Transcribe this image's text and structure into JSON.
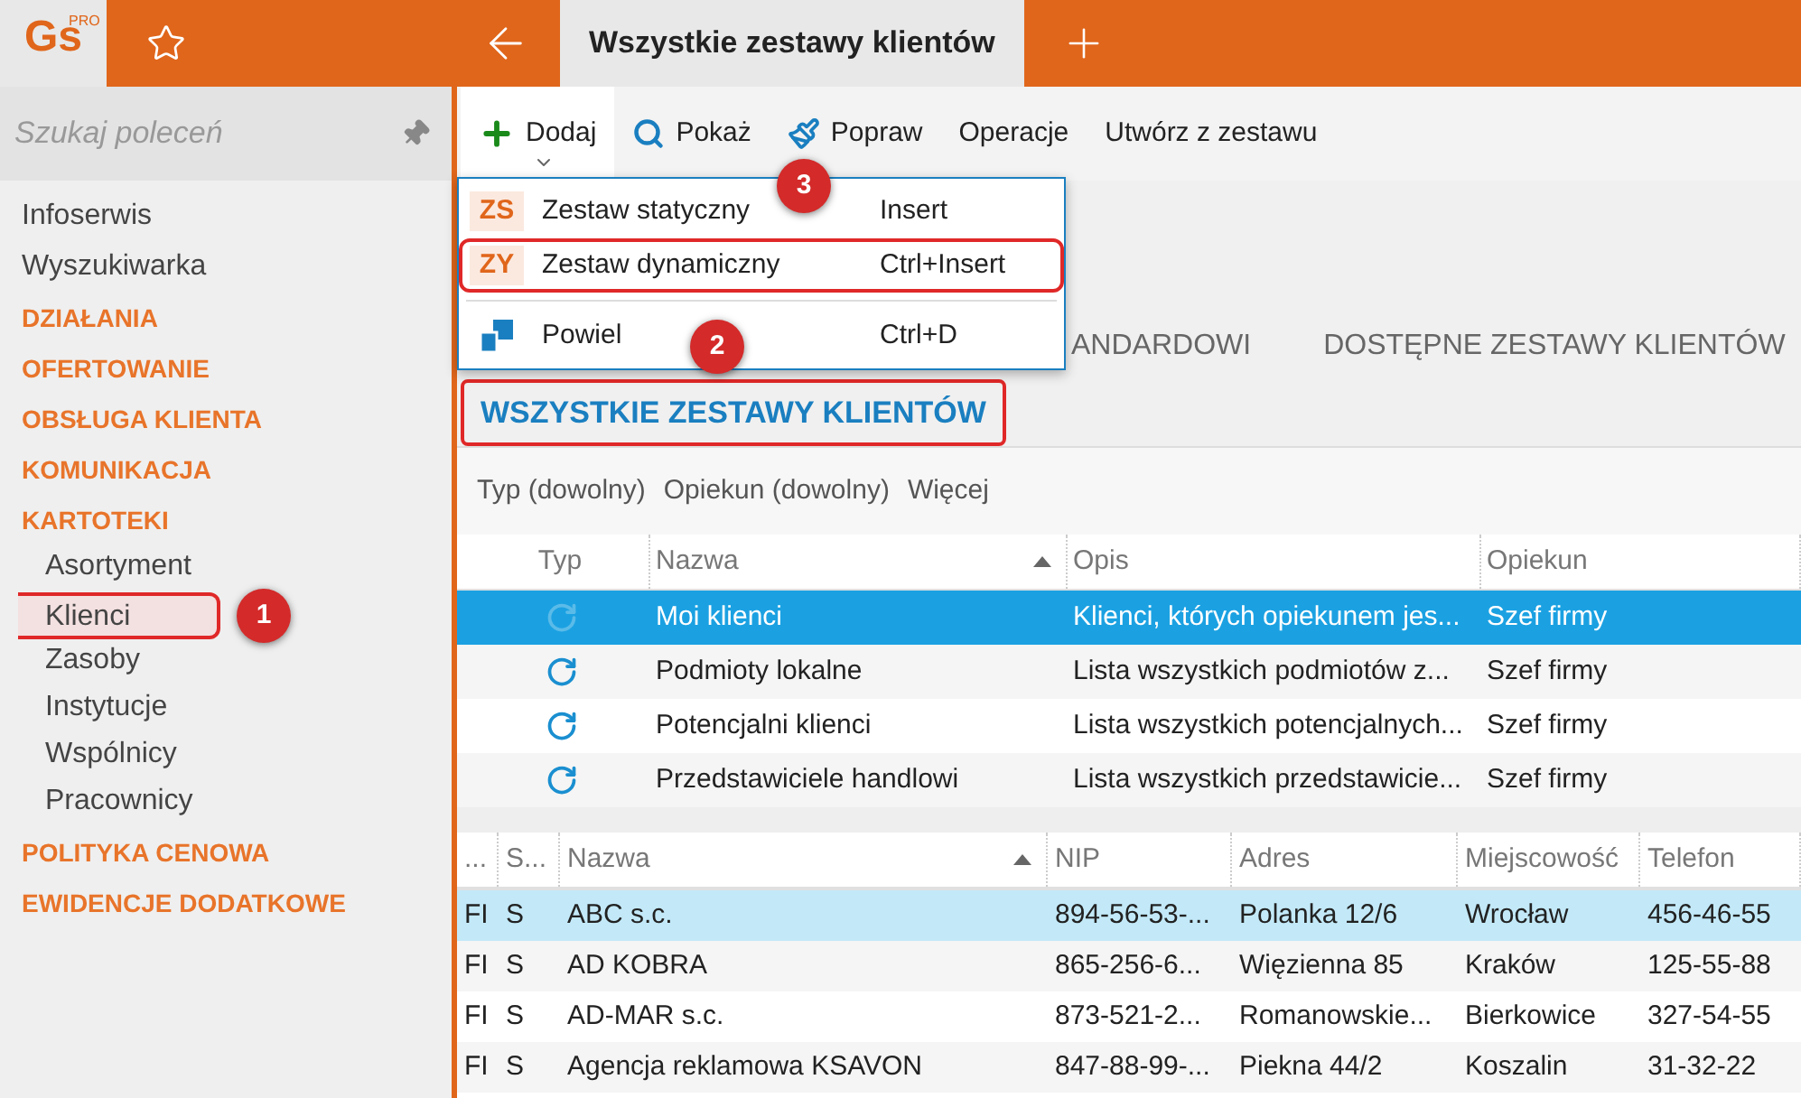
{
  "app": {
    "logo": "Gs",
    "logo_badge": "PRO"
  },
  "tabs": [
    {
      "label": "Wszystkie zestawy klientów",
      "selected": true
    }
  ],
  "sidebar": {
    "search": {
      "placeholder": "Szukaj poleceń"
    },
    "items": [
      {
        "kind": "link",
        "label": "Infoserwis"
      },
      {
        "kind": "link",
        "label": "Wyszukiwarka"
      },
      {
        "kind": "section",
        "label": "DZIAŁANIA"
      },
      {
        "kind": "section",
        "label": "OFERTOWANIE"
      },
      {
        "kind": "section",
        "label": "OBSŁUGA KLIENTA"
      },
      {
        "kind": "section",
        "label": "KOMUNIKACJA"
      },
      {
        "kind": "section",
        "label": "KARTOTEKI",
        "children": [
          {
            "label": "Asortyment",
            "highlighted": false
          },
          {
            "label": "Klienci",
            "highlighted": true,
            "badge": "1"
          },
          {
            "label": "Zasoby",
            "highlighted": false
          },
          {
            "label": "Instytucje",
            "highlighted": false
          },
          {
            "label": "Wspólnicy",
            "highlighted": false
          },
          {
            "label": "Pracownicy",
            "highlighted": false
          }
        ]
      },
      {
        "kind": "section",
        "label": "POLITYKA CENOWA"
      },
      {
        "kind": "section",
        "label": "EWIDENCJE DODATKOWE"
      }
    ]
  },
  "toolbar": [
    {
      "kind": "add",
      "label": "Dodaj",
      "expanded": true
    },
    {
      "kind": "search",
      "label": "Pokaż"
    },
    {
      "kind": "brush",
      "label": "Popraw"
    },
    {
      "kind": "text",
      "label": "Operacje"
    },
    {
      "kind": "text",
      "label": "Utwórz z zestawu"
    }
  ],
  "dropdown": [
    {
      "kind": "code",
      "code": "ZS",
      "label": "Zestaw statyczny",
      "shortcut": "Insert",
      "highlighted": false,
      "badge": "3"
    },
    {
      "kind": "code",
      "code": "ZY",
      "label": "Zestaw dynamiczny",
      "shortcut": "Ctrl+Insert",
      "highlighted": true
    },
    {
      "kind": "copy",
      "label": "Powiel",
      "shortcut": "Ctrl+D",
      "highlighted": false
    }
  ],
  "view_tabs": [
    {
      "label": "ANDARDOWI",
      "selected": false
    },
    {
      "label": "DOSTĘPNE ZESTAWY KLIENTÓW",
      "selected": false
    }
  ],
  "heading": {
    "label": "WSZYSTKIE ZESTAWY KLIENTÓW",
    "highlighted": true,
    "badge": "2"
  },
  "filters": [
    "Typ (dowolny)",
    "Opiekun (dowolny)",
    "Więcej"
  ],
  "sets_table": {
    "columns": [
      "Typ",
      "Nazwa",
      "Opis",
      "Opiekun"
    ],
    "rows": [
      {
        "name": "Moi klienci",
        "description": "Klienci, których opiekunem jes...",
        "owner": "Szef firmy",
        "selected": true
      },
      {
        "name": "Podmioty lokalne",
        "description": "Lista wszystkich podmiotów z...",
        "owner": "Szef firmy",
        "selected": false
      },
      {
        "name": "Potencjalni klienci",
        "description": "Lista wszystkich potencjalnych...",
        "owner": "Szef firmy",
        "selected": false
      },
      {
        "name": "Przedstawiciele handlowi",
        "description": "Lista wszystkich przedstawicie...",
        "owner": "Szef firmy",
        "selected": false
      }
    ]
  },
  "clients_table": {
    "columns": [
      "...",
      "S...",
      "Nazwa",
      "NIP",
      "Adres",
      "Miejscowość",
      "Telefon"
    ],
    "rows": [
      {
        "cells": [
          "FI",
          "S",
          "ABC s.c.",
          "894-56-53-...",
          "Polanka  12/6",
          "Wrocław",
          "456-46-55"
        ],
        "selected": true
      },
      {
        "cells": [
          "FI",
          "S",
          "AD KOBRA",
          "865-256-6...",
          "Więzienna  85",
          "Kraków",
          "125-55-88"
        ],
        "selected": false
      },
      {
        "cells": [
          "FI",
          "S",
          "AD-MAR s.c.",
          "873-521-2...",
          "Romanowskie...",
          "Bierkowice",
          "327-54-55"
        ],
        "selected": false
      },
      {
        "cells": [
          "FI",
          "S",
          "Agencja reklamowa KSAVON",
          "847-88-99-...",
          "Piekna  44/2",
          "Koszalin",
          "31-32-22"
        ],
        "selected": false
      }
    ]
  }
}
